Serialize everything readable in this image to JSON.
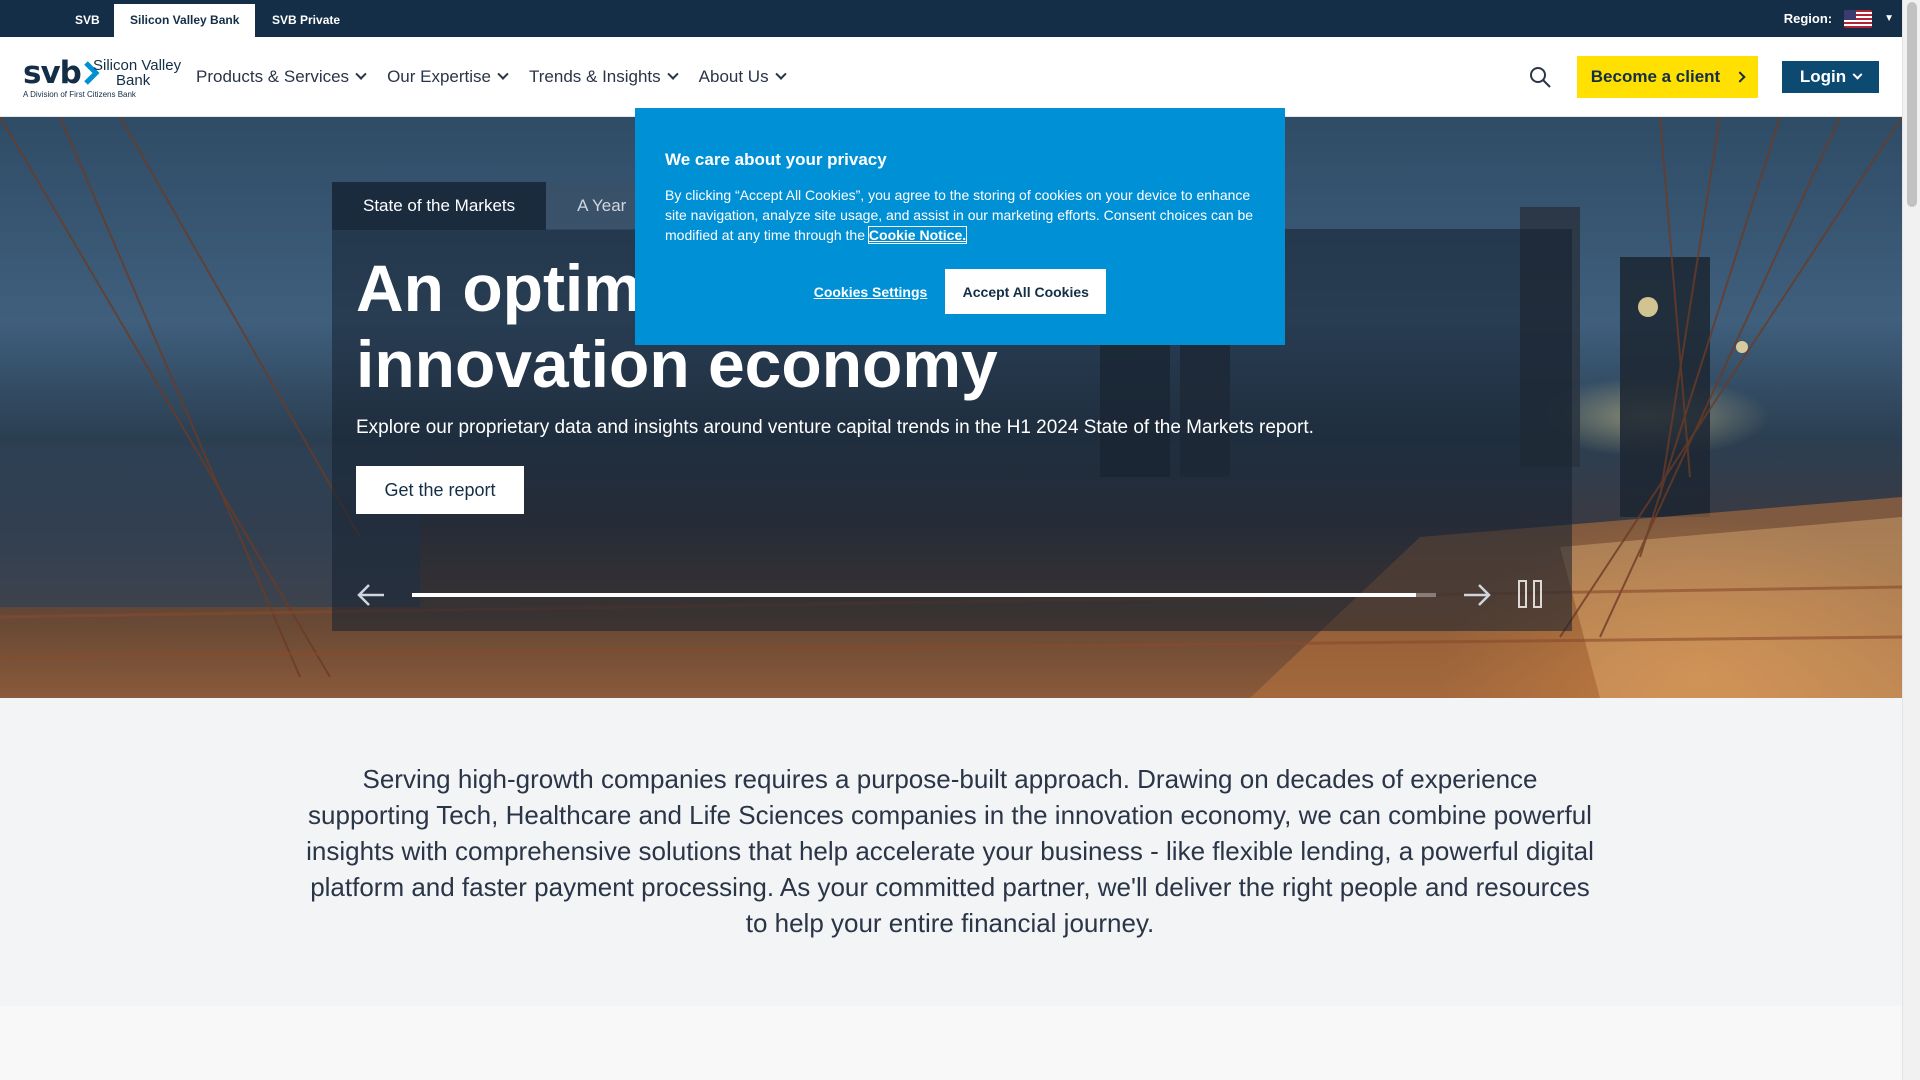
{
  "utility_bar": {
    "tabs": [
      {
        "label": "SVB"
      },
      {
        "label": "Silicon Valley Bank"
      },
      {
        "label": "SVB Private"
      }
    ],
    "region_label": "Region:"
  },
  "header": {
    "logo": {
      "mark": "svb",
      "name_line1": "Silicon Valley",
      "name_line2": "Bank",
      "tagline": "A Division of First Citizens Bank"
    },
    "nav": [
      {
        "label": "Products & Services"
      },
      {
        "label": "Our Expertise"
      },
      {
        "label": "Trends & Insights"
      },
      {
        "label": "About Us"
      }
    ],
    "search_icon": "search-icon",
    "become_client_label": "Become a client",
    "login_label": "Login"
  },
  "hero": {
    "tabs": [
      {
        "label": "State of the Markets"
      },
      {
        "label": "A Year"
      }
    ],
    "title_line1": "An optim",
    "title_line2": "innovation economy",
    "subtitle": "Explore our proprietary data and insights around venture capital trends in the H1 2024 State of the Markets report.",
    "cta_label": "Get the report",
    "progress_fraction": 0.98
  },
  "cookie_banner": {
    "title": "We care about your privacy",
    "text": "By clicking “Accept All Cookies”, you agree to the storing of cookies on your device to enhance site navigation, analyze site usage, and assist in our marketing efforts. Consent choices can be modified at any time through the",
    "link_label": "Cookie Notice.",
    "settings_label": "Cookies Settings",
    "accept_label": "Accept All Cookies"
  },
  "intro": {
    "text": "Serving high-growth companies requires a purpose-built approach. Drawing on decades of experience supporting Tech, Healthcare and Life Sciences companies in the innovation economy, we can combine powerful insights with comprehensive solutions that help accelerate your business - like flexible lending, a powerful digital platform and faster payment processing. As your committed partner, we'll deliver the right people and resources to help your entire financial journey."
  },
  "colors": {
    "navy": "#132e46",
    "cookie_blue": "#0090d5",
    "client_yellow": "#ffe000",
    "login_blue": "#0c4a72"
  }
}
